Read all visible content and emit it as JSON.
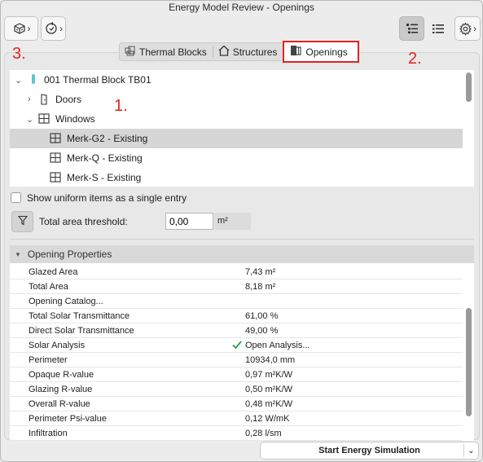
{
  "window": {
    "title": "Energy Model Review - Openings"
  },
  "annotations": {
    "a1": "1.",
    "a2": "2.",
    "a3": "3."
  },
  "tabs": [
    {
      "label": "Thermal Blocks"
    },
    {
      "label": "Structures"
    },
    {
      "label": "Openings"
    }
  ],
  "tree": {
    "block": "001 Thermal Block TB01",
    "doors": "Doors",
    "windows": "Windows",
    "items": [
      "Merk-G2 - Existing",
      "Merk-Q - Existing",
      "Merk-S - Existing"
    ]
  },
  "options": {
    "uniform_label": "Show uniform items as a single entry",
    "threshold_label": "Total area threshold:",
    "threshold_value": "0,00",
    "threshold_unit": "m²"
  },
  "properties": {
    "header": "Opening Properties",
    "rows": [
      {
        "name": "Glazed Area",
        "value": "7,43 m²"
      },
      {
        "name": "Total Area",
        "value": "8,18 m²"
      },
      {
        "name": "Opening Catalog...",
        "value": ""
      },
      {
        "name": "Total Solar Transmittance",
        "value": "61,00 %"
      },
      {
        "name": "Direct Solar Transmittance",
        "value": "49,00 %"
      },
      {
        "name": "Solar Analysis",
        "value": "Open Analysis..."
      },
      {
        "name": "Perimeter",
        "value": "10934,0 mm"
      },
      {
        "name": "Opaque R-value",
        "value": "0,97 m²K/W"
      },
      {
        "name": "Glazing R-value",
        "value": "0,50 m²K/W"
      },
      {
        "name": "Overall R-value",
        "value": "0,48 m²K/W"
      },
      {
        "name": "Perimeter Psi-value",
        "value": "0,12 W/mK"
      },
      {
        "name": "Infiltration",
        "value": "0,28 l/sm"
      }
    ]
  },
  "footer": {
    "start_label": "Start Energy Simulation"
  },
  "icons": {
    "toolbar_left": [
      "model-cube-icon",
      "refresh-cycle-icon"
    ],
    "toolbar_right": [
      "list-detail-icon",
      "list-icon",
      "gear-icon"
    ]
  },
  "colors": {
    "annotation": "#e0261f",
    "check": "#2f9e44",
    "block_marker": "#5fc4d8"
  }
}
